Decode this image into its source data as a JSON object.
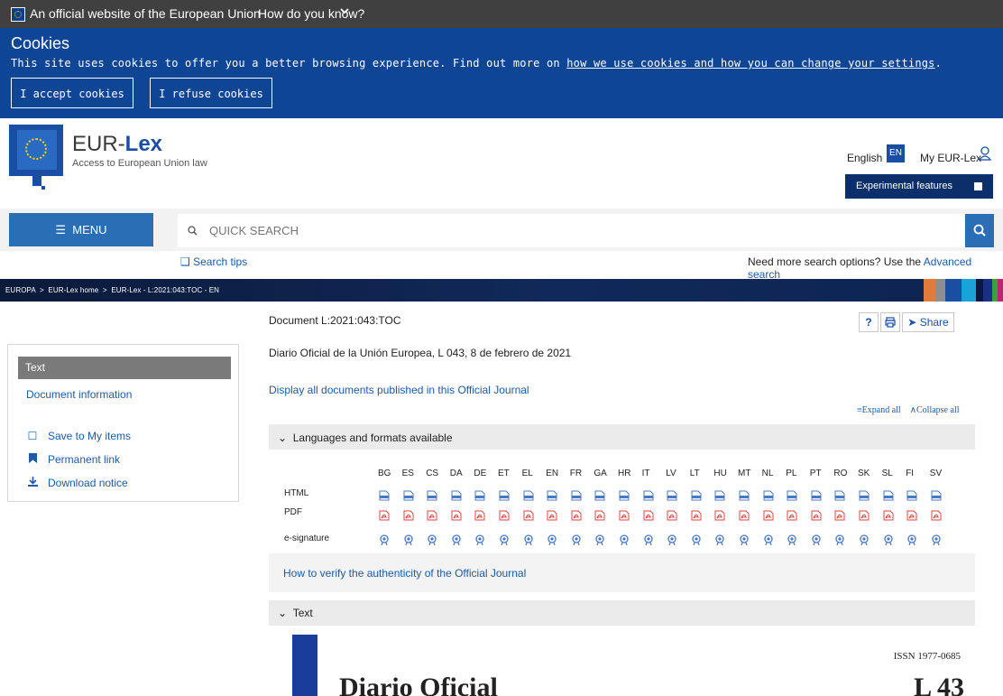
{
  "eu_bar": {
    "official": "An official website of the European Union",
    "how_know": "How do you know?"
  },
  "cookies": {
    "title": "Cookies",
    "text": "This site uses cookies to offer you a better browsing experience. Find out more on ",
    "link": "how we use cookies and how you can change your settings",
    "text_end": ".",
    "accept": "I accept cookies",
    "refuse": "I refuse cookies"
  },
  "header": {
    "title_a": "EUR-",
    "title_b": "Lex",
    "subtitle": "Access to European Union law",
    "language": "English",
    "language_code": "EN",
    "my_eurlex": "My EUR-Lex",
    "experimental": "Experimental features"
  },
  "search": {
    "menu": "MENU",
    "placeholder": "QUICK SEARCH",
    "tips": "Search tips",
    "advanced_prefix": "Need more search options? Use the ",
    "advanced_link": "Advanced search"
  },
  "breadcrumb": {
    "items": [
      "EUROPA",
      "EUR-Lex home",
      "EUR-Lex - L:2021:043:TOC - EN"
    ]
  },
  "document": {
    "id": "Document L:2021:043:TOC",
    "description": "Diario Oficial de la Unión Europea, L 043, 8 de febrero de 2021",
    "display_all": "Display all documents published in this Official Journal",
    "expand_all": "Expand all",
    "collapse_all": "Collapse all",
    "share": "Share"
  },
  "left_panel": {
    "text": "Text",
    "document_information": "Document information",
    "save": "Save to My items",
    "permanent": "Permanent link",
    "download": "Download notice"
  },
  "languages": {
    "header": "Languages and formats available",
    "codes": [
      "BG",
      "ES",
      "CS",
      "DA",
      "DE",
      "ET",
      "EL",
      "EN",
      "FR",
      "GA",
      "HR",
      "IT",
      "LV",
      "LT",
      "HU",
      "MT",
      "NL",
      "PL",
      "PT",
      "RO",
      "SK",
      "SL",
      "FI",
      "SV"
    ],
    "rows": [
      "HTML",
      "PDF",
      "e-signature"
    ],
    "verify": "How to verify the authenticity of the Official Journal"
  },
  "text_section": {
    "header": "Text",
    "issn": "ISSN 1977-0685",
    "oj_title": "Diario Oficial",
    "oj_number": "L 43"
  },
  "colors": {
    "eu_blue": "#0e4595",
    "link": "#1f5aa6",
    "menu": "#2a6fb6"
  }
}
